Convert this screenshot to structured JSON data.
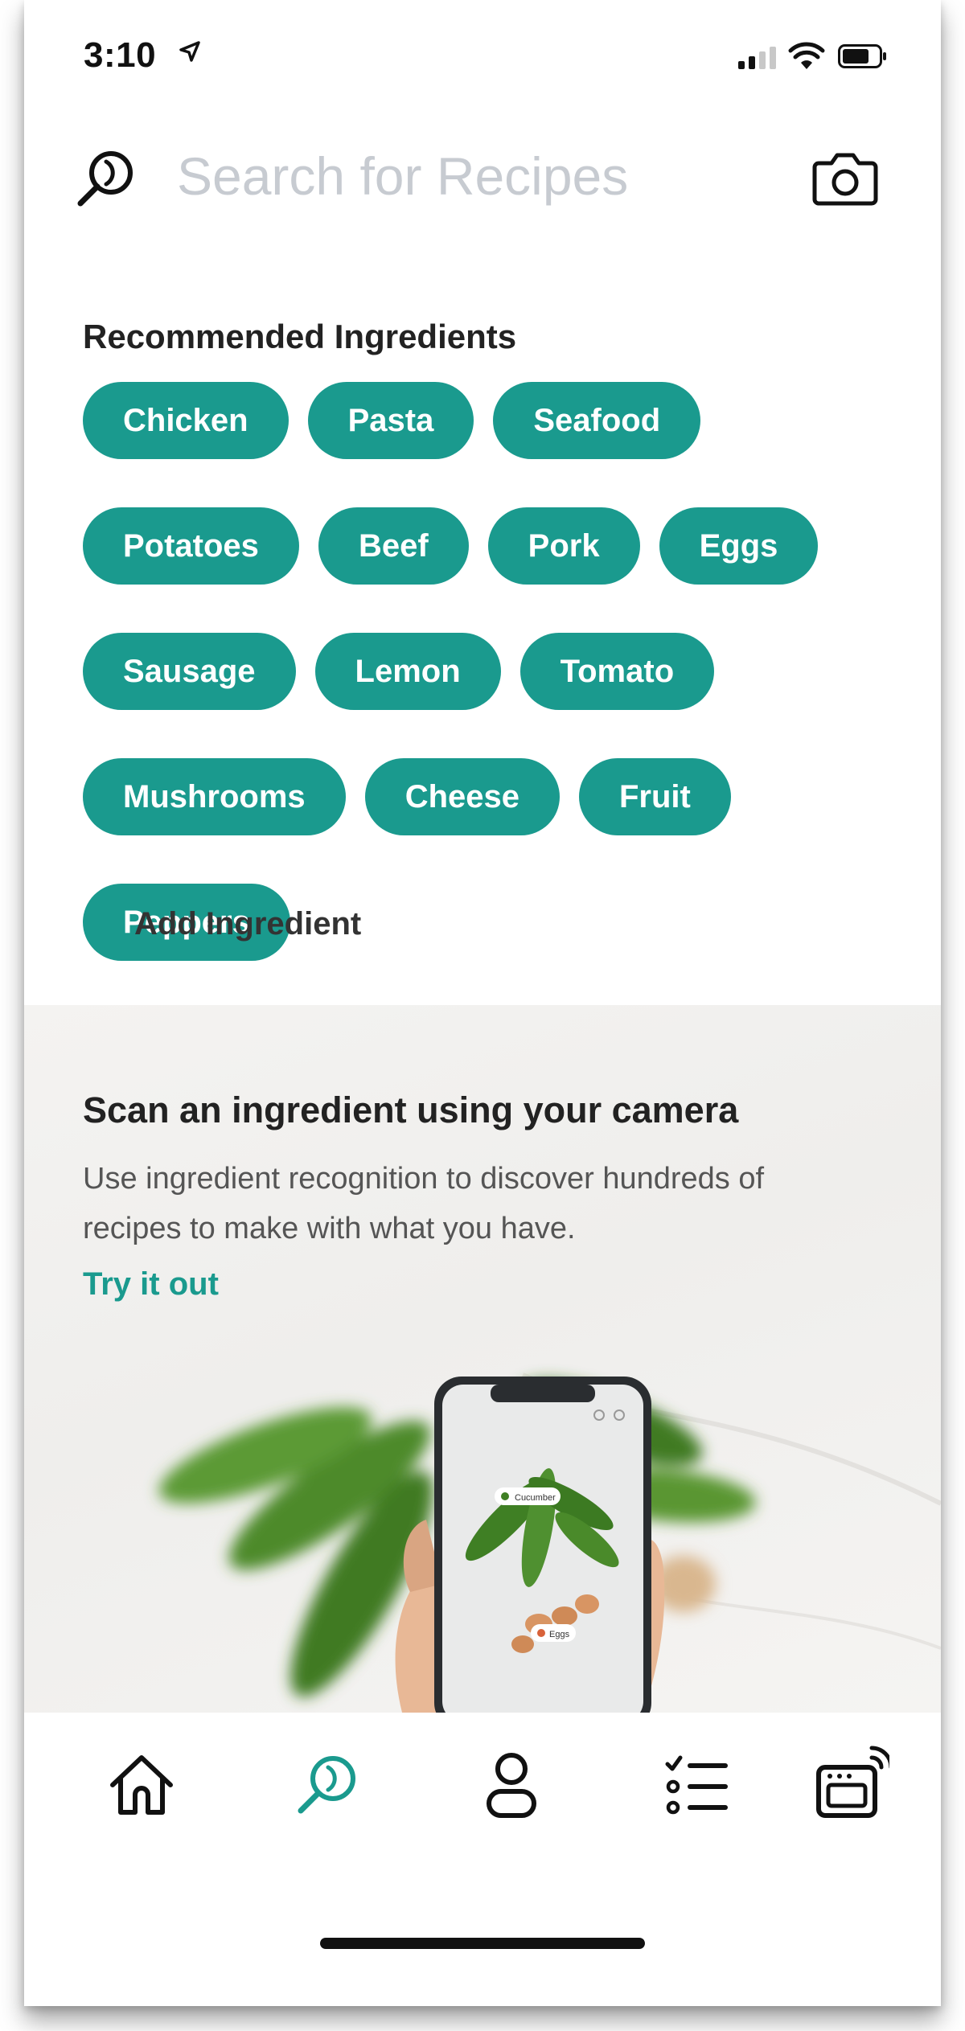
{
  "status_bar": {
    "time": "3:10"
  },
  "search": {
    "placeholder": "Search for Recipes"
  },
  "recommended": {
    "title": "Recommended Ingredients",
    "chips": [
      "Chicken",
      "Pasta",
      "Seafood",
      "Potatoes",
      "Beef",
      "Pork",
      "Eggs",
      "Sausage",
      "Lemon",
      "Tomato",
      "Mushrooms",
      "Cheese",
      "Fruit",
      "Peppers"
    ]
  },
  "add_ingredient": {
    "label": "Add Ingredient"
  },
  "scan_promo": {
    "title": "Scan an ingredient using your camera",
    "description": "Use ingredient recognition to discover hundreds of recipes to make with what you have.",
    "cta": "Try it out",
    "tag_cucumber": "Cucumber",
    "tag_eggs": "Eggs"
  },
  "tab_bar": {
    "tabs": [
      {
        "icon": "home-icon",
        "active": false
      },
      {
        "icon": "search-icon",
        "active": true
      },
      {
        "icon": "profile-icon",
        "active": false
      },
      {
        "icon": "checklist-icon",
        "active": false
      },
      {
        "icon": "connected-oven-icon",
        "active": false
      }
    ]
  },
  "colors": {
    "accent": "#1a9a8e",
    "chip_text": "#ffffff",
    "placeholder": "#c7cbd1",
    "heading": "#222222"
  }
}
